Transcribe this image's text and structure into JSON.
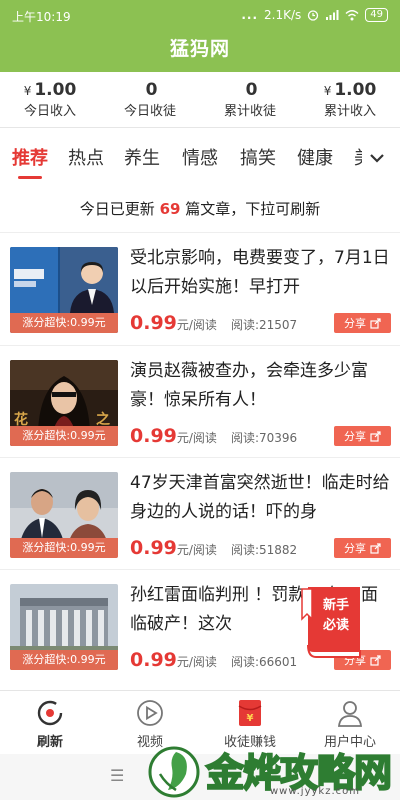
{
  "status_bar": {
    "time": "上午10:19",
    "dots": "...",
    "speed": "2.1K/s",
    "battery": "49"
  },
  "app": {
    "title": "猛犸网",
    "header_color": "#8cc152",
    "accent": "#e53935"
  },
  "stats": [
    {
      "value": "1.00",
      "currency": "¥",
      "label": "今日收入"
    },
    {
      "value": "0",
      "currency": "",
      "label": "今日收徒"
    },
    {
      "value": "0",
      "currency": "",
      "label": "累计收徒"
    },
    {
      "value": "1.00",
      "currency": "¥",
      "label": "累计收入"
    }
  ],
  "tabs": [
    "推荐",
    "热点",
    "养生",
    "情感",
    "搞笑",
    "健康",
    "美"
  ],
  "active_tab": "推荐",
  "banner": {
    "prefix": "今日已更新",
    "count": "69",
    "suffix": "篇文章，下拉可刷新"
  },
  "articles": [
    {
      "title": "受北京影响，电费要变了，7月1日以后开始实施！早打开",
      "ribbon": "涨分超快:0.99元",
      "price": "0.99",
      "unit": "元/阅读",
      "reads": "阅读:21507",
      "share": "分享"
    },
    {
      "title": "演员赵薇被查办，会牵连多少富豪！惊呆所有人！",
      "ribbon": "涨分超快:0.99元",
      "price": "0.99",
      "unit": "元/阅读",
      "reads": "阅读:70396",
      "share": "分享"
    },
    {
      "title": "47岁天津首富突然逝世！临走时给身边的人说的话！吓的身",
      "ribbon": "涨分超快:0.99元",
      "price": "0.99",
      "unit": "元/阅读",
      "reads": "阅读:51882",
      "share": "分享"
    },
    {
      "title": "孙红雷面临判刑 ！罚款90亿，面临破产！这次",
      "ribbon": "涨分超快:0.99元",
      "price": "0.99",
      "unit": "元/阅读",
      "reads": "阅读:66601",
      "share": "分享"
    }
  ],
  "float_badge": {
    "line1": "新手",
    "line2": "必读"
  },
  "bottom_nav": [
    {
      "label": "刷新",
      "icon": "refresh-icon"
    },
    {
      "label": "视频",
      "icon": "play-icon"
    },
    {
      "label": "收徒赚钱",
      "icon": "red-envelope-icon"
    },
    {
      "label": "用户中心",
      "icon": "user-icon"
    }
  ],
  "watermark": {
    "text": "金烨攻略网",
    "url": "www.jyykz.com"
  }
}
